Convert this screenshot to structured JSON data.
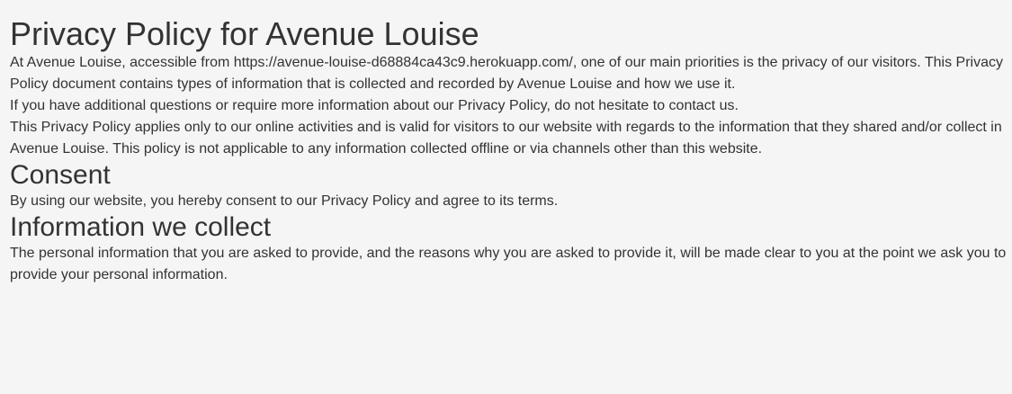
{
  "page": {
    "title": "Privacy Policy for Avenue Louise",
    "intro_paragraph_1": "At Avenue Louise, accessible from https://avenue-louise-d68884ca43c9.herokuapp.com/, one of our main priorities is the privacy of our visitors. This Privacy Policy document contains types of information that is collected and recorded by Avenue Louise and how we use it.",
    "intro_paragraph_2": "If you have additional questions or require more information about our Privacy Policy, do not hesitate to contact us.",
    "intro_paragraph_3": "This Privacy Policy applies only to our online activities and is valid for visitors to our website with regards to the information that they shared and/or collect in Avenue Louise. This policy is not applicable to any information collected offline or via channels other than this website."
  },
  "consent": {
    "heading": "Consent",
    "text": "By using our website, you hereby consent to our Privacy Policy and agree to its terms."
  },
  "information_we_collect": {
    "heading": "Information we collect",
    "text": "The personal information that you are asked to provide, and the reasons why you are asked to provide it, will be made clear to you at the point we ask you to provide your personal information."
  },
  "colors": {
    "background": "#f5f5f5",
    "text": "#333333"
  }
}
